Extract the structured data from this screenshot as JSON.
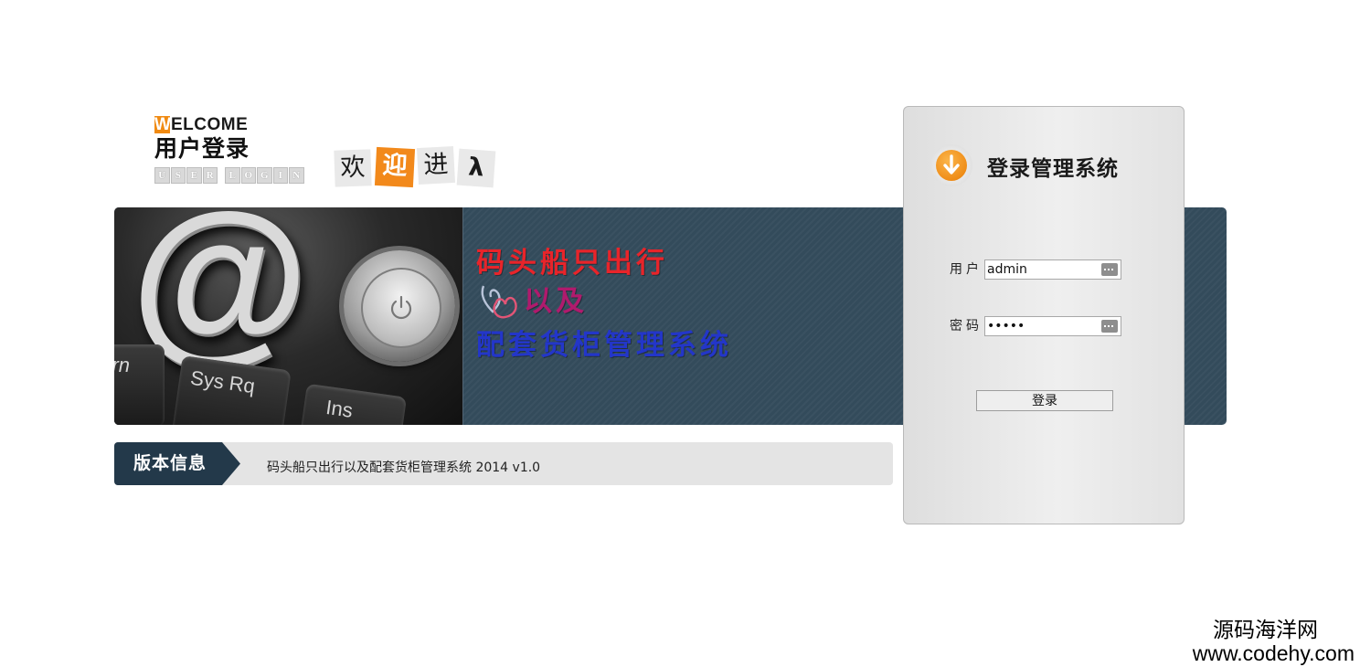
{
  "header": {
    "welcome_first_letter": "W",
    "welcome_rest": "ELCOME",
    "login_cn": "用户登录",
    "login_en_letters": [
      "U",
      "S",
      "E",
      "R",
      "",
      "L",
      "O",
      "G",
      "I",
      "N"
    ],
    "welcome_tiles": [
      "欢",
      "迎",
      "进",
      "λ"
    ]
  },
  "banner": {
    "key_labels": [
      "rn",
      "Sys Rq",
      "Ins"
    ],
    "line1": "码头船只出行",
    "line2": "以及",
    "line3": "配套货柜管理系统"
  },
  "version": {
    "tag": "版本信息",
    "text": "码头船只出行以及配套货柜管理系统 2014 v1.0"
  },
  "login": {
    "title": "登录管理系统",
    "username_label": "用户",
    "username_value": "admin",
    "password_label": "密码",
    "password_value": "•••••",
    "submit_label": "登录"
  },
  "watermark": {
    "name": "源码海洋网",
    "url": "www.codehy.com"
  },
  "colors": {
    "accent_orange": "#f08a12",
    "banner_bg": "#334b5b",
    "version_tag_bg": "#23394a",
    "banner_line1": "#e8242a",
    "banner_line2": "#b01a6d",
    "banner_line3": "#2336c9"
  }
}
